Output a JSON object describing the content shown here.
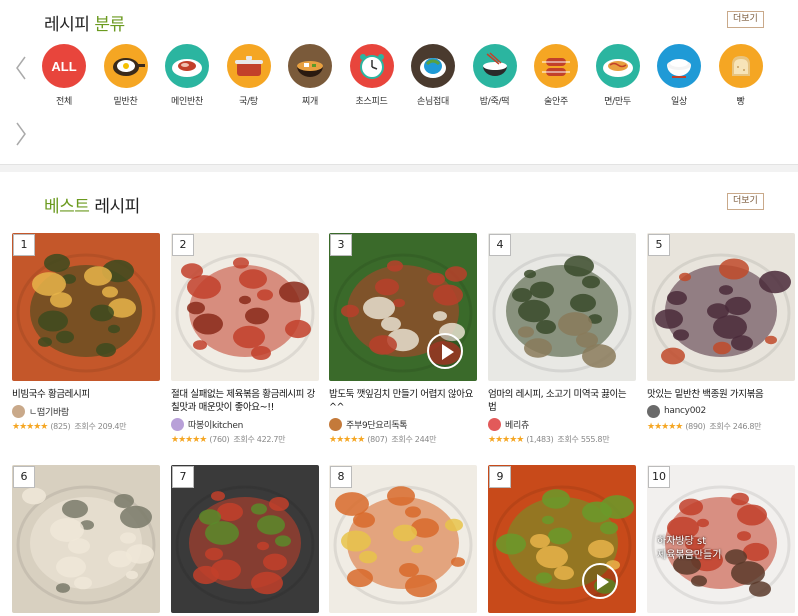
{
  "category_section": {
    "title_prefix": "레시피",
    "title_accent": "분류",
    "more_label": "더보기"
  },
  "categories": [
    {
      "label": "전체",
      "icon": "all-badge-icon",
      "color": "#e8453c",
      "text": "ALL"
    },
    {
      "label": "밑반찬",
      "icon": "fried-egg-pan-icon",
      "color": "#f5a623"
    },
    {
      "label": "메인반찬",
      "icon": "meat-plate-icon",
      "color": "#2bb5a0"
    },
    {
      "label": "국/탕",
      "icon": "soup-pot-icon",
      "color": "#f5a623"
    },
    {
      "label": "찌개",
      "icon": "stew-bowl-icon",
      "color": "#7a5a3a"
    },
    {
      "label": "초스피드",
      "icon": "alarm-clock-icon",
      "color": "#e8453c"
    },
    {
      "label": "손님접대",
      "icon": "serving-dish-icon",
      "color": "#4a3a2e"
    },
    {
      "label": "밥/죽/떡",
      "icon": "rice-bowl-chopsticks-icon",
      "color": "#2bb5a0"
    },
    {
      "label": "술안주",
      "icon": "sausage-skewer-icon",
      "color": "#f5a623"
    },
    {
      "label": "면/만두",
      "icon": "noodle-plate-icon",
      "color": "#2bb5a0"
    },
    {
      "label": "일상",
      "icon": "rice-bowl-icon",
      "color": "#1f9ad6"
    },
    {
      "label": "빵",
      "icon": "bread-toast-icon",
      "color": "#f5a623"
    }
  ],
  "best_section": {
    "title_accent": "베스트",
    "title_suffix": "레시피",
    "more_label": "더보기"
  },
  "recipes": [
    {
      "rank": "1",
      "title": "비빔국수 황금레시피",
      "author": "ㄴ떱기바람",
      "avatar_color": "#c9a98a",
      "reviews": "(825)",
      "views": "조회수 209.4만",
      "rating": 5,
      "palette": [
        "#c4572a",
        "#3d4a1e",
        "#e8b44a"
      ],
      "video": false
    },
    {
      "rank": "2",
      "title": "절대 실패없는 제육볶음 황금레시피 강칠맛과 매운맛이 좋아요~!!",
      "author": "따봉이kitchen",
      "avatar_color": "#b8a0d8",
      "reviews": "(760)",
      "views": "조회수 422.7만",
      "rating": 5,
      "palette": [
        "#f0ece4",
        "#c2402a",
        "#8a2a1a"
      ],
      "video": false
    },
    {
      "rank": "3",
      "title": "밥도둑 깻잎김치 만들기 어렵지 않아요^^",
      "author": "주부9단요리독톡",
      "avatar_color": "#c47a3a",
      "reviews": "(807)",
      "views": "조회수 244만",
      "rating": 5,
      "palette": [
        "#3a6a2a",
        "#b8402a",
        "#e8e0d0"
      ],
      "video": true
    },
    {
      "rank": "4",
      "title": "엄마의 레시피, 소고기 미역국 끓이는 법",
      "author": "베리츄",
      "avatar_color": "#e25a5a",
      "reviews": "(1,483)",
      "views": "조회수 555.8만",
      "rating": 5,
      "palette": [
        "#e8e8e4",
        "#3a4a2a",
        "#8a7a5a"
      ],
      "video": false
    },
    {
      "rank": "5",
      "title": "맛있는 밑반찬 백종원 가지볶음",
      "author": "hancy002",
      "avatar_color": "#6a6a6a",
      "reviews": "(890)",
      "views": "조회수 246.8만",
      "rating": 5,
      "palette": [
        "#e8e4dc",
        "#4a2a3a",
        "#c04a2a"
      ],
      "video": false
    },
    {
      "rank": "6",
      "title": "",
      "author": "",
      "palette": [
        "#d8d0c0",
        "#f0e8d8",
        "#7a7a6a"
      ],
      "video": false
    },
    {
      "rank": "7",
      "title": "",
      "author": "",
      "palette": [
        "#3a3a3a",
        "#c2402a",
        "#5a8a2a"
      ],
      "video": false
    },
    {
      "rank": "8",
      "title": "",
      "author": "",
      "palette": [
        "#f0ece4",
        "#d86a2a",
        "#e8c44a"
      ],
      "video": false
    },
    {
      "rank": "9",
      "title": "",
      "author": "",
      "palette": [
        "#c84a1a",
        "#6a9a2a",
        "#e8b44a"
      ],
      "video": true
    },
    {
      "rank": "10",
      "title": "",
      "author": "",
      "palette": [
        "#f2f0ee",
        "#c2402a",
        "#5a3a2a"
      ],
      "video": false,
      "overlay_text": "하자방당 st\n제육볶음만들기"
    }
  ],
  "icons": {
    "prev": "chevron-left-icon",
    "next": "chevron-right-icon",
    "star": "star-icon",
    "play": "play-icon"
  }
}
